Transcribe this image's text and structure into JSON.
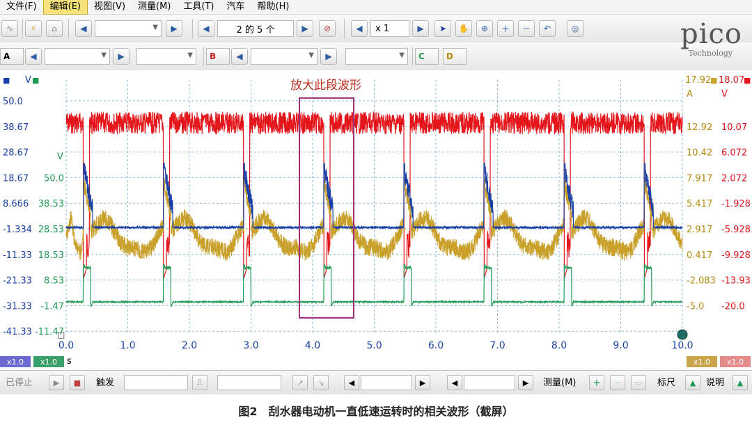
{
  "menu": {
    "items": [
      "文件(F)",
      "编辑(E)",
      "视图(V)",
      "测量(M)",
      "工具(T)",
      "汽车",
      "帮助(H)"
    ],
    "active_index": 1
  },
  "toolbar1": {
    "page_label": "2 的 5 个",
    "zoom_label": "x 1"
  },
  "toolbar2": {
    "channel_a": "A",
    "channel_b": "B",
    "channel_c": "C",
    "channel_d": "D"
  },
  "logo": {
    "name": "pico",
    "sub": "Technology"
  },
  "annotation": {
    "text": "放大此段波形"
  },
  "colors": {
    "red": "#e4161b",
    "blue": "#1a3fa6",
    "gold": "#c8a02a",
    "green": "#1f9a55",
    "annotation": "#a0307a",
    "grid": "#8fb8d6"
  },
  "chart_data": {
    "type": "line",
    "xlabel": "s",
    "x_ticks": [
      "0.0",
      "1.0",
      "2.0",
      "3.0",
      "4.0",
      "5.0",
      "6.0",
      "7.0",
      "8.0",
      "9.0",
      "10.0"
    ],
    "xlim": [
      0,
      10
    ],
    "axes": {
      "blue_left": {
        "unit": "V",
        "ticks": [
          "50.0",
          "38.67",
          "28.67",
          "18.67",
          "8.666",
          "-1.334",
          "-11.33",
          "-21.33",
          "-31.33",
          "-41.33"
        ],
        "ylim": [
          -41.33,
          50.0
        ]
      },
      "green_left": {
        "unit": "V",
        "ticks": [
          "50.0",
          "38.53",
          "28.53",
          "18.53",
          "8.53",
          "-1.47",
          "-11.47"
        ],
        "ylim": [
          -11.47,
          50.0
        ]
      },
      "gold_right": {
        "unit": "A",
        "top": "17.92",
        "ticks": [
          "12.92",
          "10.42",
          "7.917",
          "5.417",
          "2.917",
          "0.417",
          "-2.083",
          "-5.0"
        ]
      },
      "red_right": {
        "unit": "V",
        "top": "18.07",
        "ticks": [
          "10.07",
          "6.072",
          "2.072",
          "-1.928",
          "-5.928",
          "-9.928",
          "-13.93",
          "-20.0"
        ]
      }
    },
    "scale_labels": {
      "blue": "x1.0",
      "green": "x1.0",
      "gold": "x1.0",
      "red": "x1.0"
    },
    "period_s": 1.3,
    "pulse_starts_s": [
      0.28,
      1.58,
      2.88,
      4.18,
      5.48,
      6.78,
      8.08,
      9.38
    ],
    "series": [
      {
        "color_key": "red",
        "axis": "red_right",
        "shape": "supply voltage, dips at each wiper stroke"
      },
      {
        "color_key": "blue",
        "axis": "blue_left",
        "shape": "spike then flat"
      },
      {
        "color_key": "gold",
        "axis": "gold_right",
        "shape": "noisy current sawtooth"
      },
      {
        "color_key": "green",
        "axis": "green_left",
        "shape": "square pulses"
      }
    ]
  },
  "statusbar": {
    "stopped": "已停止",
    "trigger": "触发",
    "measure": "测量(M)",
    "ruler": "标尺",
    "legend": "说明"
  },
  "caption": "图2　刮水器电动机一直低速运转时的相关波形（截屏）"
}
